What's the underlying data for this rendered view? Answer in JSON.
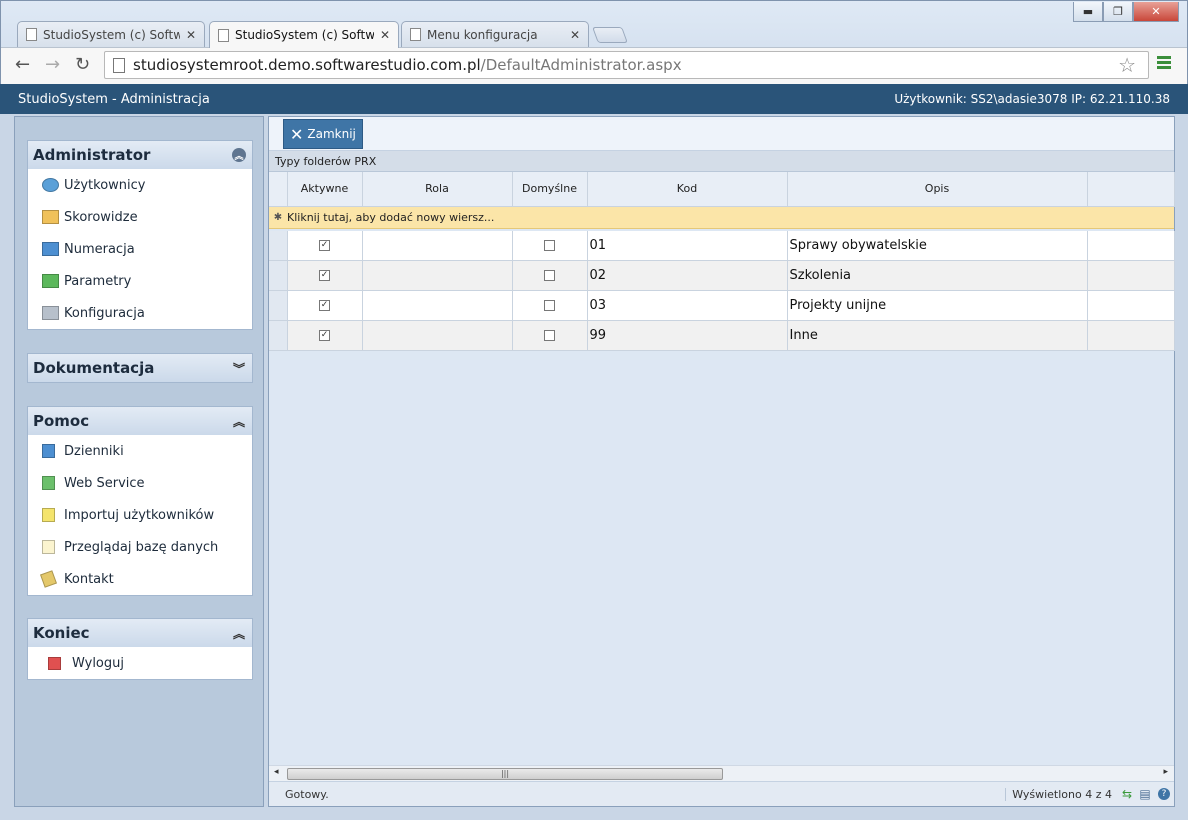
{
  "browser": {
    "tabs": [
      {
        "title": "StudioSystem (c) Software",
        "active": false
      },
      {
        "title": "StudioSystem (c) Software",
        "active": true
      },
      {
        "title": "Menu konfiguracja",
        "active": false
      }
    ],
    "tab_close": "✕",
    "window_buttons": {
      "minimize": "▬",
      "maximize": "❐",
      "close": "✕"
    },
    "nav": {
      "back": "←",
      "forward": "→",
      "reload": "↻"
    },
    "url_host": "studiosystemroot.demo.softwarestudio.com.pl",
    "url_path": "/DefaultAdministrator.aspx",
    "star": "☆"
  },
  "app": {
    "title": "StudioSystem - Administracja",
    "user_info": "Użytkownik: SS2\\adasie3078 IP: 62.21.110.38"
  },
  "sidebar": {
    "panels": [
      {
        "title": "Administrator",
        "toggle": "︽",
        "items": [
          {
            "label": "Użytkownicy",
            "icon": "users-icon",
            "color": "#5aa0d8"
          },
          {
            "label": "Skorowidze",
            "icon": "folder-icon",
            "color": "#f0c15a"
          },
          {
            "label": "Numeracja",
            "icon": "folder-blue-icon",
            "color": "#4d8fd1"
          },
          {
            "label": "Parametry",
            "icon": "folder-green-icon",
            "color": "#5cb85c"
          },
          {
            "label": "Konfiguracja",
            "icon": "folder-gray-icon",
            "color": "#b7c0cb"
          }
        ]
      },
      {
        "title": "Dokumentacja",
        "toggle": "︾",
        "items": []
      },
      {
        "title": "Pomoc",
        "toggle": "︽",
        "items": [
          {
            "label": "Dzienniki",
            "icon": "book-blue-icon",
            "color": "#4d8fd1"
          },
          {
            "label": "Web Service",
            "icon": "book-green-icon",
            "color": "#6cc06c"
          },
          {
            "label": "Importuj użytkowników",
            "icon": "note-yellow-icon",
            "color": "#f4e46c"
          },
          {
            "label": "Przeglądaj bazę danych",
            "icon": "document-icon",
            "color": "#fbf4cf"
          },
          {
            "label": "Kontakt",
            "icon": "contact-card-icon",
            "color": "#e4c86a"
          }
        ]
      },
      {
        "title": "Koniec",
        "toggle": "︽",
        "items": [
          {
            "label": "Wyloguj",
            "icon": "logout-red-icon",
            "color": "#e05050"
          }
        ]
      }
    ]
  },
  "main": {
    "close_label": "Zamknij",
    "close_glyph": "✕",
    "grid_title": "Typy folderów PRX",
    "columns": [
      "Aktywne",
      "Rola",
      "Domyślne",
      "Kod",
      "Opis"
    ],
    "new_row_hint": "Kliknij tutaj, aby dodać nowy wiersz...",
    "new_row_marker": "✱",
    "rows": [
      {
        "aktywne": true,
        "rola": "",
        "domyslne": false,
        "kod": "01",
        "opis": "Sprawy obywatelskie"
      },
      {
        "aktywne": true,
        "rola": "",
        "domyslne": false,
        "kod": "02",
        "opis": "Szkolenia"
      },
      {
        "aktywne": true,
        "rola": "",
        "domyslne": false,
        "kod": "03",
        "opis": "Projekty unijne"
      },
      {
        "aktywne": true,
        "rola": "",
        "domyslne": false,
        "kod": "99",
        "opis": "Inne"
      }
    ],
    "scroll": {
      "left": "◂",
      "right": "▸",
      "grip": "|||"
    },
    "status_ready": "Gotowy.",
    "status_count": "Wyświetlono 4 z 4",
    "status_icons": {
      "refresh": "⇆",
      "export": "▤",
      "help": "?"
    }
  }
}
